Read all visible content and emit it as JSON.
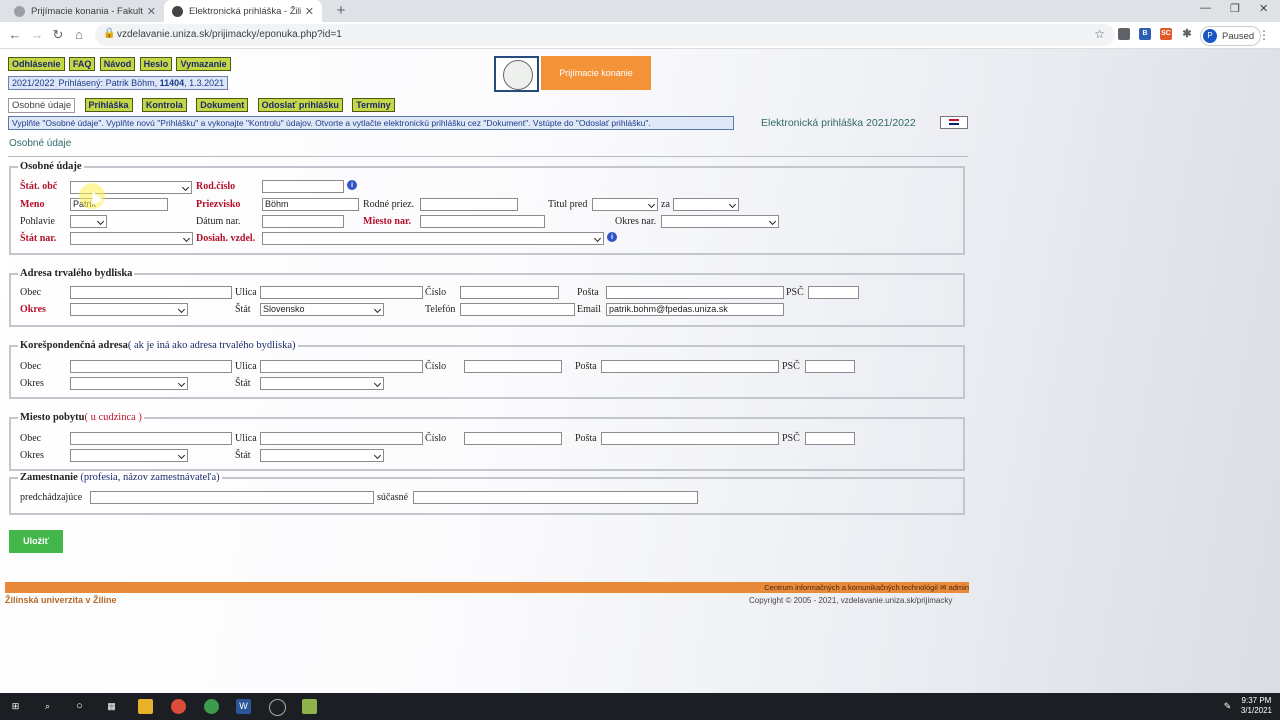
{
  "browser": {
    "tabs": [
      {
        "title": "Prijímacie konania - Fakulta prev",
        "active": false
      },
      {
        "title": "Elektronická prihláška - Žilinská u",
        "active": true
      }
    ],
    "new_tab": "+",
    "url": "vzdelavanie.uniza.sk/prijimacky/eponuka.php?id=1",
    "profile_initial": "P",
    "profile_status": "Paused",
    "extensions": [
      "B",
      "SC"
    ]
  },
  "top_buttons": [
    "Odhlásenie",
    "FAQ",
    "Návod",
    "Heslo",
    "Vymazanie"
  ],
  "user_info": {
    "year": "2021/2022",
    "label": "Prihlásený: Patrik Böhm,",
    "id": "11404",
    "date": ", 1.3.2021"
  },
  "header": {
    "banner": "Prijímacie konanie"
  },
  "nav": {
    "current": "Osobné údaje",
    "items": [
      "Prihláška",
      "Kontrola",
      "Dokument",
      "Odoslať prihlášku",
      "Termíny"
    ]
  },
  "instruction": "Vyplňte \"Osobné údaje\". Vyplňte novú \"Prihlášku\" a vykonajte \"Kontrolu\" údajov. Otvorte a vytlačte elektronickú prihlášku cez \"Dokument\". Vstúpte do \"Odoslať prihlášku\".",
  "form_title": "Elektronická prihláška 2021/2022",
  "breadcrumb": "Osobné údaje",
  "personal": {
    "legend": "Osobné údaje",
    "stat_obc": "Štát. obč",
    "rod_cislo": "Rod.číslo",
    "meno": "Meno",
    "meno_value": "Patrik",
    "priezvisko": "Priezvisko",
    "priezvisko_value": "Böhm",
    "rodne_priez": "Rodné priez.",
    "titul_pred": "Titul pred",
    "za": "za",
    "pohlavie": "Pohlavie",
    "datum_nar": "Dátum nar.",
    "miesto_nar": "Miesto nar.",
    "okres_nar": "Okres nar.",
    "stat_nar": "Štát nar.",
    "dosiah_vzdel": "Dosiah. vzdel."
  },
  "permanent": {
    "legend": "Adresa trvalého bydliska",
    "obec": "Obec",
    "ulica": "Ulica",
    "cislo": "Číslo",
    "posta": "Pošta",
    "psc": "PSČ",
    "okres": "Okres",
    "stat": "Štát",
    "stat_value": "Slovensko",
    "telefon": "Telefón",
    "email": "Email",
    "email_value": "patrik.bohm@fpedas.uniza.sk"
  },
  "correspondence": {
    "legend": "Korešpondenčná adresa",
    "legend_note": "( ak je iná ako adresa trvalého bydliska)",
    "obec": "Obec",
    "ulica": "Ulica",
    "cislo": "Číslo",
    "posta": "Pošta",
    "psc": "PSČ",
    "okres": "Okres",
    "stat": "Štát"
  },
  "residence": {
    "legend": "Miesto pobytu",
    "legend_note": "( u cudzinca )",
    "obec": "Obec",
    "ulica": "Ulica",
    "cislo": "Číslo",
    "posta": "Pošta",
    "psc": "PSČ",
    "okres": "Okres",
    "stat": "Štát"
  },
  "employment": {
    "legend": "Zamestnanie",
    "legend_note": "(profesia, názov zamestnávateľa)",
    "previous": "predchádzajúce",
    "current": "súčasné"
  },
  "save_button": "Uložiť",
  "footer": {
    "center": "Centrum informačných a komunikačných technológií",
    "admin": "admin",
    "university": "Žilinská univerzita v Žiline",
    "copyright": "Copyright © 2005 - 2021, vzdelavanie.uniza.sk/prijimacky"
  },
  "taskbar": {
    "time": "9:37 PM",
    "date": "3/1/2021"
  },
  "colors": {
    "button": "#c5d646",
    "banner": "#f39237",
    "save": "#43b64a",
    "required": "#b2102a"
  }
}
